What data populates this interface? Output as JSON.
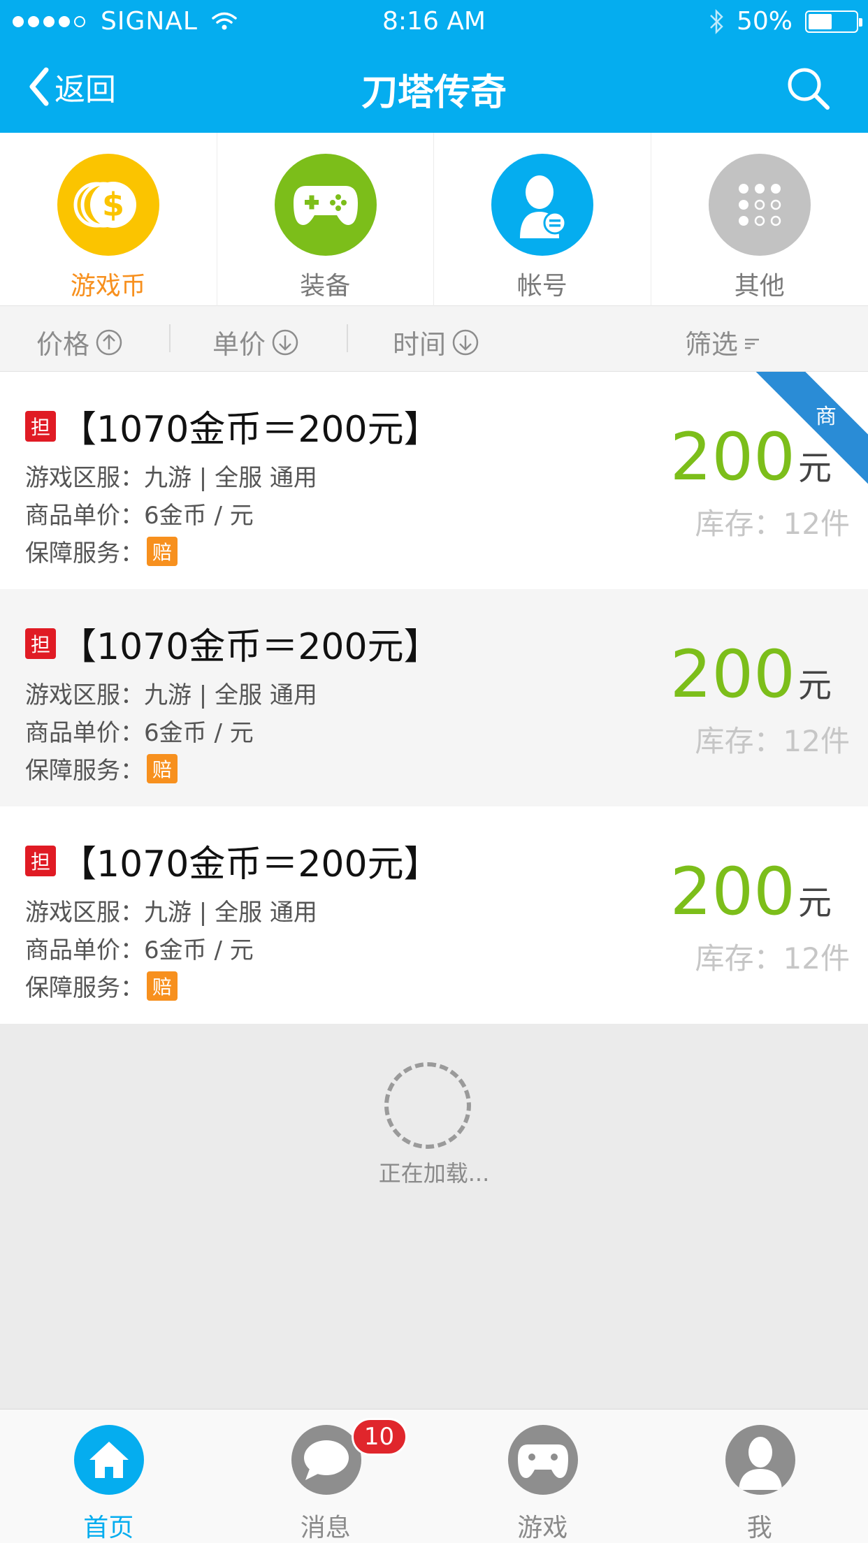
{
  "status_bar": {
    "carrier": "SIGNAL",
    "time": "8:16 AM",
    "battery": "50%",
    "battery_level": 0.5
  },
  "header": {
    "back_label": "返回",
    "title": "刀塔传奇"
  },
  "categories": [
    {
      "label": "游戏币",
      "icon": "coin-icon",
      "color": "#fbc400",
      "active": true
    },
    {
      "label": "装备",
      "icon": "gamepad-icon",
      "color": "#7cbe1a",
      "active": false
    },
    {
      "label": "帐号",
      "icon": "account-icon",
      "color": "#05adef",
      "active": false
    },
    {
      "label": "其他",
      "icon": "grid-icon",
      "color": "#c2c2c2",
      "active": false
    }
  ],
  "sort_bar": {
    "price": "价格",
    "unit_price": "单价",
    "time": "时间",
    "filter": "筛选"
  },
  "listings": [
    {
      "badge": "担",
      "title": "【1070金币＝200元】",
      "server_label": "游戏区服：",
      "server_value": "九游 | 全服 通用",
      "unit_label": "商品单价：",
      "unit_value": "6金币 / 元",
      "service_label": "保障服务：",
      "service_badge": "赔",
      "price": "200",
      "price_unit": "元",
      "stock": "库存：12件",
      "merchant_tag": "商"
    },
    {
      "badge": "担",
      "title": "【1070金币＝200元】",
      "server_label": "游戏区服：",
      "server_value": "九游 | 全服 通用",
      "unit_label": "商品单价：",
      "unit_value": "6金币 / 元",
      "service_label": "保障服务：",
      "service_badge": "赔",
      "price": "200",
      "price_unit": "元",
      "stock": "库存：12件"
    },
    {
      "badge": "担",
      "title": "【1070金币＝200元】",
      "server_label": "游戏区服：",
      "server_value": "九游 | 全服 通用",
      "unit_label": "商品单价：",
      "unit_value": "6金币 / 元",
      "service_label": "保障服务：",
      "service_badge": "赔",
      "price": "200",
      "price_unit": "元",
      "stock": "库存：12件"
    }
  ],
  "loading_text": "正在加载...",
  "tab_bar": [
    {
      "label": "首页",
      "icon": "home-icon",
      "active": true
    },
    {
      "label": "消息",
      "icon": "chat-icon",
      "active": false,
      "badge": "10"
    },
    {
      "label": "游戏",
      "icon": "game-icon",
      "active": false
    },
    {
      "label": "我",
      "icon": "user-icon",
      "active": false
    }
  ],
  "colors": {
    "accent": "#05adef",
    "price_green": "#7cbe1a",
    "active_orange": "#f7901e",
    "guarantee_red": "#e01b24"
  }
}
